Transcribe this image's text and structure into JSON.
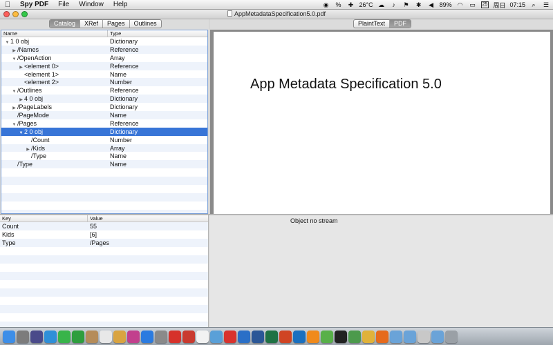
{
  "menubar": {
    "apple": "",
    "items": [
      "Spy PDF",
      "File",
      "Window",
      "Help"
    ],
    "status": {
      "percent_icon": "%",
      "temperature": "26°C",
      "battery": "89%",
      "date_badge": "25",
      "weekday": "周日",
      "time": "07:15"
    }
  },
  "window": {
    "title": "AppMetadataSpecification5.0.pdf"
  },
  "left_tabs": [
    "Catalog",
    "XRef",
    "Pages",
    "Outlines"
  ],
  "right_tabs": [
    "PlaintText",
    "PDF"
  ],
  "outline": {
    "columns": [
      "Name",
      "Type"
    ],
    "rows": [
      {
        "toggle": "▼",
        "name": "1 0 obj",
        "type": "Dictionary"
      },
      {
        "toggle": "▶",
        "name": "/Names",
        "type": "Reference"
      },
      {
        "toggle": "▼",
        "name": "/OpenAction",
        "type": "Array"
      },
      {
        "toggle": "▶",
        "name": "<element 0>",
        "type": "Reference"
      },
      {
        "toggle": "",
        "name": "<element 1>",
        "type": "Name"
      },
      {
        "toggle": "",
        "name": "<element 2>",
        "type": "Number"
      },
      {
        "toggle": "▼",
        "name": "/Outlines",
        "type": "Reference"
      },
      {
        "toggle": "▶",
        "name": "4 0 obj",
        "type": "Dictionary"
      },
      {
        "toggle": "▶",
        "name": "/PageLabels",
        "type": "Dictionary"
      },
      {
        "toggle": "",
        "name": "/PageMode",
        "type": "Name"
      },
      {
        "toggle": "▼",
        "name": "/Pages",
        "type": "Reference"
      },
      {
        "toggle": "▼",
        "name": "2 0 obj",
        "type": "Dictionary"
      },
      {
        "toggle": "",
        "name": "/Count",
        "type": "Number"
      },
      {
        "toggle": "▶",
        "name": "/Kids",
        "type": "Array"
      },
      {
        "toggle": "",
        "name": "/Type",
        "type": "Name"
      },
      {
        "toggle": "",
        "name": "/Type",
        "type": "Name"
      }
    ]
  },
  "preview": {
    "page_title": "App Metadata Specification 5.0"
  },
  "kv": {
    "columns": [
      "Key",
      "Value"
    ],
    "rows": [
      {
        "key": "Count",
        "value": "55"
      },
      {
        "key": "Kids",
        "value": "[6]"
      },
      {
        "key": "Type",
        "value": "/Pages"
      }
    ]
  },
  "stream": {
    "text": "Object  no stream"
  },
  "colors": {
    "selection": "#3875d7",
    "close": "#fc605b",
    "minimize": "#fdbc40",
    "zoom": "#34c84a"
  },
  "dock": {
    "icons": [
      "finder-icon",
      "launchpad-icon",
      "mission-control-icon",
      "safari-icon",
      "messages-icon",
      "facetime-icon",
      "contacts-icon",
      "calendar-icon",
      "photos-icon",
      "itunes-icon",
      "app-store-icon",
      "preferences-icon",
      "acrobat-icon",
      "pdf-icon",
      "textedit-icon",
      "preview-icon",
      "wps-icon",
      "xcode-icon",
      "word-icon",
      "excel-icon",
      "powerpoint-icon",
      "outlook-icon",
      "vlc-icon",
      "evernote-icon",
      "terminal-icon",
      "activity-icon",
      "chrome-icon",
      "firefox-icon",
      "folder-icon",
      "downloads-icon",
      "docs-icon",
      "music-folder-icon",
      "trash-icon"
    ]
  }
}
